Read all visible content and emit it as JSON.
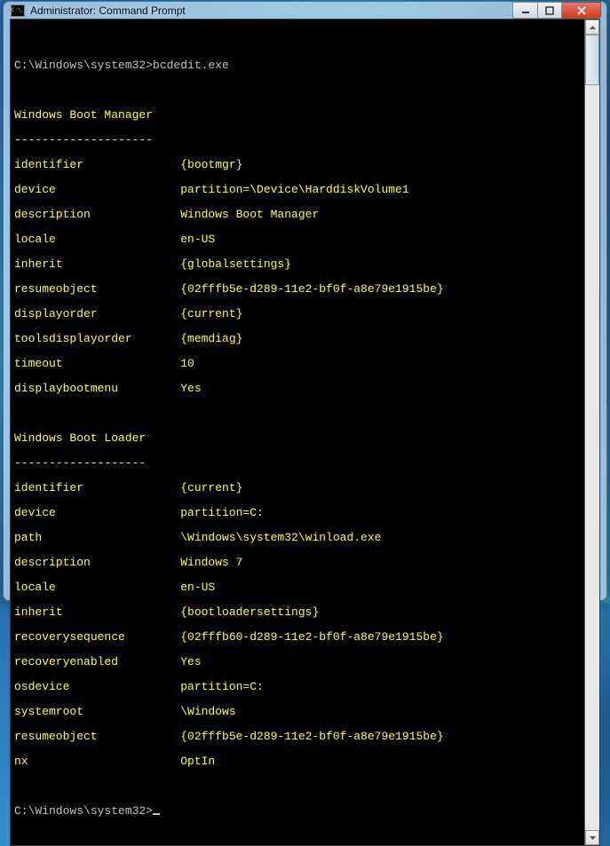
{
  "window": {
    "title": "Administrator: Command Prompt"
  },
  "prompt1": {
    "path": "C:\\Windows\\system32>",
    "cmd": "bcdedit.exe"
  },
  "section1": {
    "header": "Windows Boot Manager",
    "underline": "--------------------",
    "rows": [
      {
        "label": "identifier",
        "value": "{bootmgr}"
      },
      {
        "label": "device",
        "value": "partition=\\Device\\HarddiskVolume1"
      },
      {
        "label": "description",
        "value": "Windows Boot Manager"
      },
      {
        "label": "locale",
        "value": "en-US"
      },
      {
        "label": "inherit",
        "value": "{globalsettings}"
      },
      {
        "label": "resumeobject",
        "value": "{02fffb5e-d289-11e2-bf0f-a8e79e1915be}"
      },
      {
        "label": "displayorder",
        "value": "{current}"
      },
      {
        "label": "toolsdisplayorder",
        "value": "{memdiag}"
      },
      {
        "label": "timeout",
        "value": "10"
      },
      {
        "label": "displaybootmenu",
        "value": "Yes"
      }
    ]
  },
  "section2": {
    "header": "Windows Boot Loader",
    "underline": "-------------------",
    "rows": [
      {
        "label": "identifier",
        "value": "{current}"
      },
      {
        "label": "device",
        "value": "partition=C:"
      },
      {
        "label": "path",
        "value": "\\Windows\\system32\\winload.exe"
      },
      {
        "label": "description",
        "value": "Windows 7"
      },
      {
        "label": "locale",
        "value": "en-US"
      },
      {
        "label": "inherit",
        "value": "{bootloadersettings}"
      },
      {
        "label": "recoverysequence",
        "value": "{02fffb60-d289-11e2-bf0f-a8e79e1915be}"
      },
      {
        "label": "recoveryenabled",
        "value": "Yes"
      },
      {
        "label": "osdevice",
        "value": "partition=C:"
      },
      {
        "label": "systemroot",
        "value": "\\Windows"
      },
      {
        "label": "resumeobject",
        "value": "{02fffb5e-d289-11e2-bf0f-a8e79e1915be}"
      },
      {
        "label": "nx",
        "value": "OptIn"
      }
    ]
  },
  "prompt2": {
    "path": "C:\\Windows\\system32>"
  }
}
